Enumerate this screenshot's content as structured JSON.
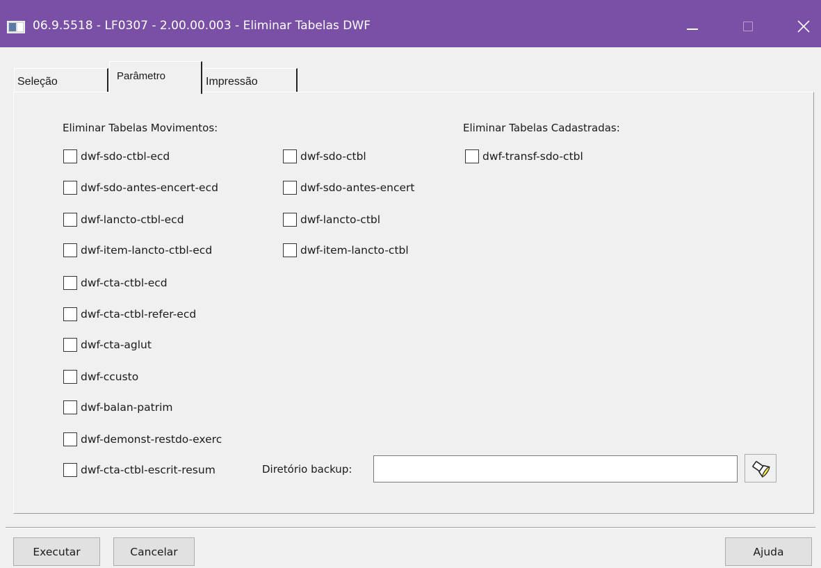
{
  "window": {
    "title": "06.9.5518 - LF0307 - 2.00.00.003 - Eliminar Tabelas DWF",
    "minimize": "—",
    "maximize": "□",
    "close": "✕"
  },
  "tabs": [
    {
      "label": "Seleção",
      "active": false
    },
    {
      "label": "Parâmetro",
      "active": true
    },
    {
      "label": "Impressão",
      "active": false
    }
  ],
  "parametro": {
    "movimentos_heading": "Eliminar Tabelas Movimentos:",
    "cadastradas_heading": "Eliminar Tabelas Cadastradas:",
    "movimentos_col1": [
      {
        "label": "dwf-sdo-ctbl-ecd",
        "checked": false
      },
      {
        "label": "dwf-sdo-antes-encert-ecd",
        "checked": false
      },
      {
        "label": "dwf-lancto-ctbl-ecd",
        "checked": false
      },
      {
        "label": "dwf-item-lancto-ctbl-ecd",
        "checked": false
      },
      {
        "label": "dwf-cta-ctbl-ecd",
        "checked": false
      },
      {
        "label": "dwf-cta-ctbl-refer-ecd",
        "checked": false
      },
      {
        "label": "dwf-cta-aglut",
        "checked": false
      },
      {
        "label": "dwf-ccusto",
        "checked": false
      },
      {
        "label": "dwf-balan-patrim",
        "checked": false
      },
      {
        "label": "dwf-demonst-restdo-exerc",
        "checked": false
      },
      {
        "label": "dwf-cta-ctbl-escrit-resum",
        "checked": false
      }
    ],
    "movimentos_col2": [
      {
        "label": "dwf-sdo-ctbl",
        "checked": false
      },
      {
        "label": "dwf-sdo-antes-encert",
        "checked": false
      },
      {
        "label": "dwf-lancto-ctbl",
        "checked": false
      },
      {
        "label": "dwf-item-lancto-ctbl",
        "checked": false
      }
    ],
    "cadastradas": [
      {
        "label": "dwf-transf-sdo-ctbl",
        "checked": false
      }
    ],
    "backup_label": "Diretório backup:",
    "backup_value": "",
    "browse_icon": "flashlight-search-icon"
  },
  "footer": {
    "executar": "Executar",
    "cancelar": "Cancelar",
    "ajuda": "Ajuda"
  },
  "colors": {
    "titlebar": "#7a4fa6",
    "background": "#f0f0f0"
  }
}
